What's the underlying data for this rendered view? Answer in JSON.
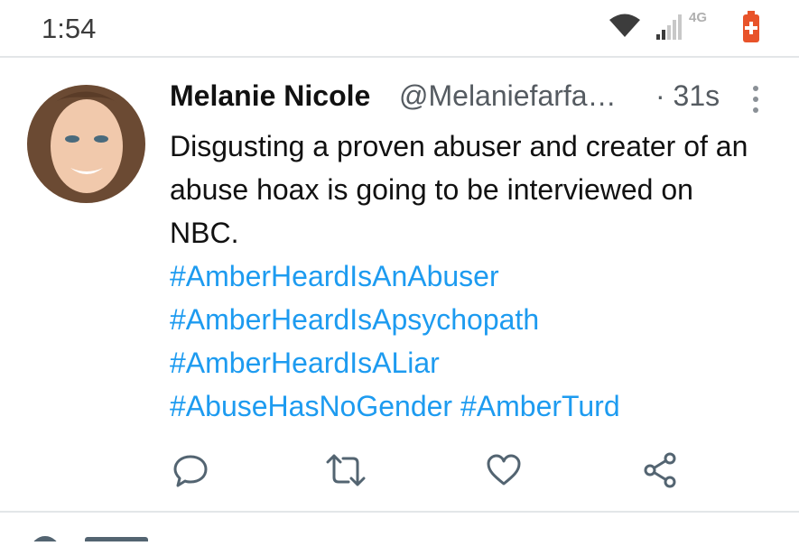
{
  "status_bar": {
    "time": "1:54",
    "network": "4G",
    "battery_color": "#e8532a"
  },
  "tweet": {
    "author_name": "Melanie Nicole",
    "author_handle": "@Melaniefarfa…",
    "timestamp": "· 31s",
    "text": "Disgusting a proven abuser and creater of an abuse hoax is going to be interviewed on NBC.",
    "hashtags": [
      "#AmberHeardIsAnAbuser",
      "#AmberHeardIsApsychopath",
      "#AmberHeardIsALiar",
      "#AbuseHasNoGender #AmberTurd"
    ],
    "hashtag_color": "#1d9bf0"
  },
  "actions": {
    "reply": "reply-icon",
    "retweet": "retweet-icon",
    "like": "heart-icon",
    "share": "share-icon"
  }
}
